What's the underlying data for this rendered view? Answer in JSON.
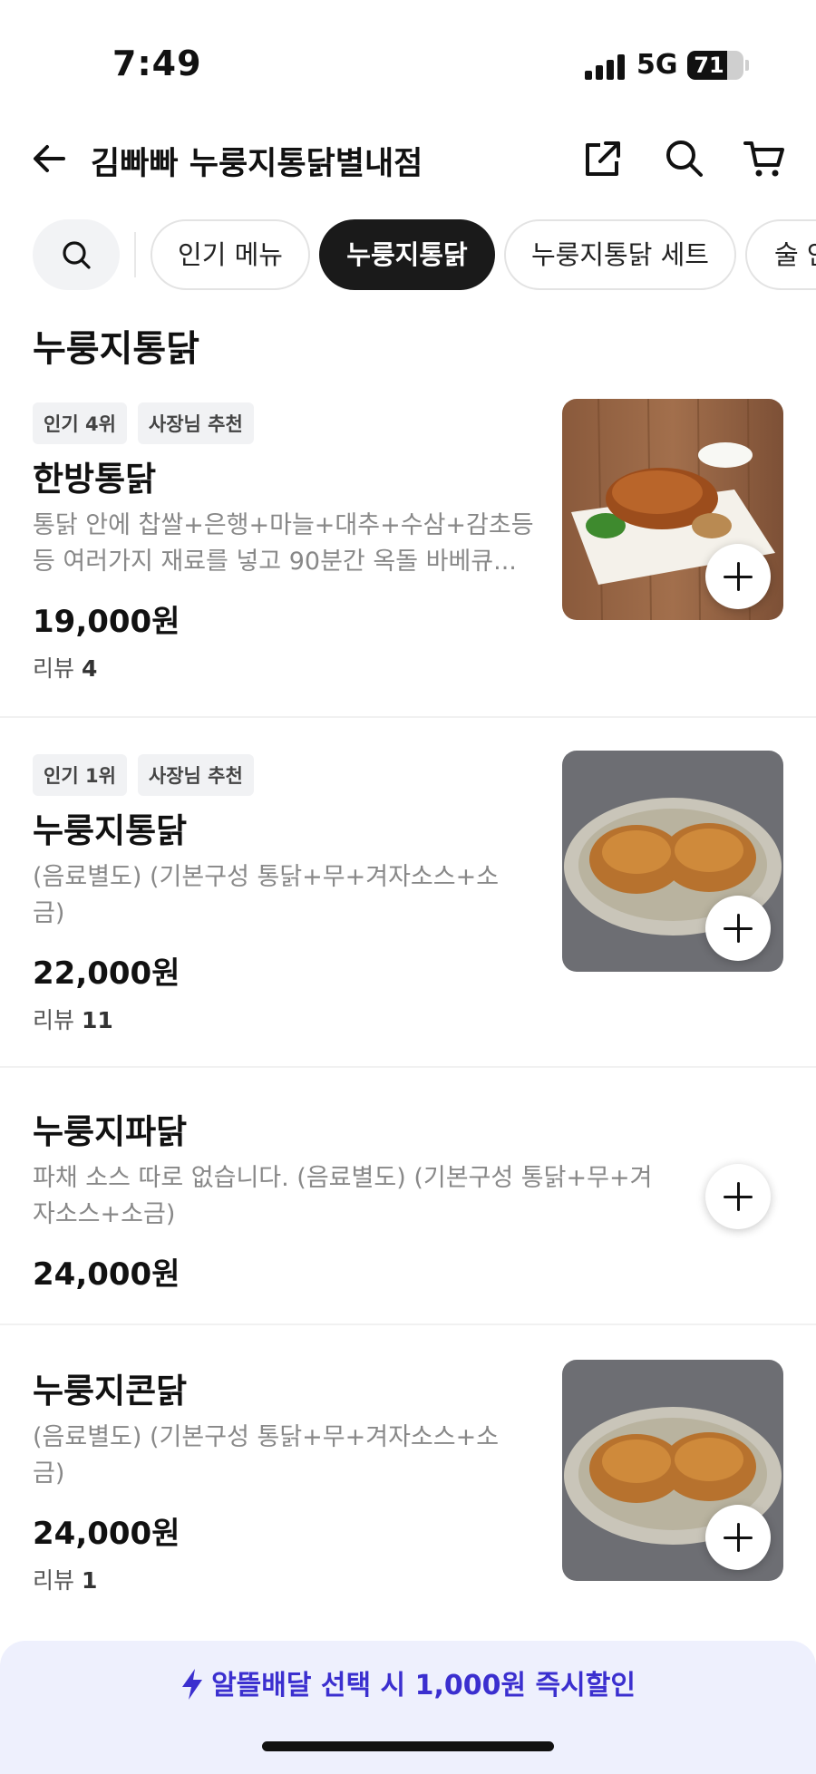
{
  "status_bar": {
    "time": "7:49",
    "network": "5G",
    "battery": "71",
    "battery_level": 0.71
  },
  "header": {
    "store_name": "김빠빠 누룽지통닭별내점"
  },
  "chips": [
    {
      "label": "인기 메뉴",
      "active": false
    },
    {
      "label": "누룽지통닭",
      "active": true
    },
    {
      "label": "누룽지통닭 세트",
      "active": false
    },
    {
      "label": "술 안",
      "active": false
    }
  ],
  "section": {
    "title": "누룽지통닭"
  },
  "items": [
    {
      "badges": [
        "인기 4위",
        "사장님 추천"
      ],
      "name": "한방통닭",
      "desc_line1": "통닭 안에 찹쌀+은행+마늘+대추+수삼+감초등",
      "desc_line2": "등 여러가지 재료를 넣고 90분간 옥돌 바베큐...",
      "price": "19,000원",
      "review_label": "리뷰",
      "review_count": "4"
    },
    {
      "badges": [
        "인기 1위",
        "사장님 추천"
      ],
      "name": "누룽지통닭",
      "desc_line1": "(음료별도) (기본구성 통닭+무+겨자소스+소",
      "desc_line2": "금)",
      "price": "22,000원",
      "review_label": "리뷰",
      "review_count": "11"
    },
    {
      "badges": [],
      "name": "누룽지파닭",
      "desc_line1": "파채 소스 따로 없습니다. (음료별도) (기본구성 통닭+무+겨",
      "desc_line2": "자소스+소금)",
      "price": "24,000원"
    },
    {
      "badges": [],
      "name": "누룽지콘닭",
      "desc_line1": "(음료별도) (기본구성 통닭+무+겨자소스+소",
      "desc_line2": "금)",
      "price": "24,000원",
      "review_label": "리뷰",
      "review_count": "1"
    }
  ],
  "promo": {
    "text": "알뜰배달 선택 시 1,000원 즉시할인"
  },
  "colors": {
    "accent": "#3b2fcf",
    "chip_active": "#1a1a1a",
    "promo_bg": "#eef0fd"
  }
}
